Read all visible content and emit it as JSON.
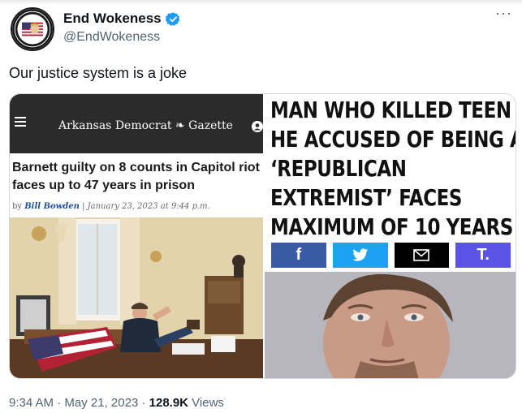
{
  "author": {
    "display_name": "End Wokeness",
    "handle": "@EndWokeness",
    "verified": true,
    "avatar_text": "SUPPORT THE FORMER TRUMP"
  },
  "more_label": "···",
  "tweet": {
    "text": "Our justice system is a joke"
  },
  "left_image": {
    "paper_name": "Arkansas Democrat ❧ Gazette",
    "headline_line1": "Barnett guilty on 8 counts in Capitol riot",
    "headline_line2": "faces up to 47 years in prison",
    "byline_prefix": "by ",
    "byline_author": "Bill Bowden",
    "byline_sep": " | ",
    "byline_date": "January 23, 2023 at 9:44 p.m."
  },
  "right_image": {
    "headline_lines": [
      "MAN WHO KILLED TEEN",
      "HE ACCUSED OF BEING A",
      "‘REPUBLICAN",
      "EXTREMIST’ FACES",
      "MAXIMUM OF 10 YEARS"
    ],
    "share_buttons": [
      {
        "name": "facebook",
        "glyph": "f"
      },
      {
        "name": "twitter",
        "glyph": "❦"
      },
      {
        "name": "email",
        "glyph": "✉"
      },
      {
        "name": "truth",
        "glyph": "T."
      }
    ]
  },
  "meta": {
    "time": "9:34 AM",
    "separator": " · ",
    "date": "May 21, 2023",
    "views_count": "128.9K",
    "views_label": " Views"
  },
  "colors": {
    "verified_blue": "#1d9bf0",
    "secondary_text": "#536471",
    "facebook": "#3b5aa6",
    "twitter": "#1da1f2",
    "truth": "#5a53e6"
  }
}
